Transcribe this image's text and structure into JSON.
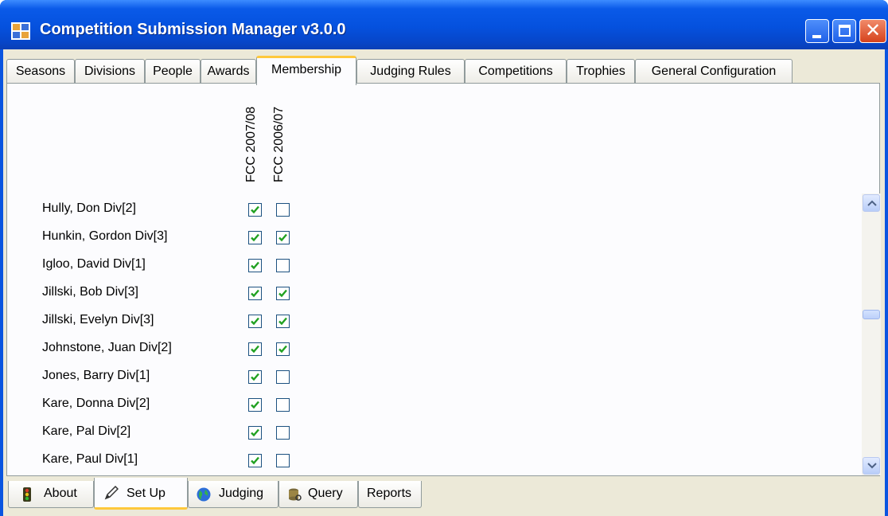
{
  "window": {
    "title": "Competition Submission Manager v3.0.0"
  },
  "top_tabs": [
    {
      "label": "Seasons",
      "active": false
    },
    {
      "label": "Divisions",
      "active": false
    },
    {
      "label": "People",
      "active": false
    },
    {
      "label": "Awards",
      "active": false
    },
    {
      "label": "Membership",
      "active": true
    },
    {
      "label": "Judging Rules",
      "active": false
    },
    {
      "label": "Competitions",
      "active": false
    },
    {
      "label": "Trophies",
      "active": false
    },
    {
      "label": "General Configuration",
      "active": false
    }
  ],
  "membership": {
    "columns": [
      "FCC 2007/08",
      "FCC 2006/07"
    ],
    "rows": [
      {
        "label": "Hully, Don    Div[2]",
        "checked": [
          true,
          false
        ]
      },
      {
        "label": "Hunkin, Gordon    Div[3]",
        "checked": [
          true,
          true
        ]
      },
      {
        "label": "Igloo, David    Div[1]",
        "checked": [
          true,
          false
        ]
      },
      {
        "label": "Jillski, Bob    Div[3]",
        "checked": [
          true,
          true
        ]
      },
      {
        "label": "Jillski, Evelyn    Div[3]",
        "checked": [
          true,
          true
        ]
      },
      {
        "label": "Johnstone, Juan    Div[2]",
        "checked": [
          true,
          true
        ]
      },
      {
        "label": "Jones, Barry    Div[1]",
        "checked": [
          true,
          false
        ]
      },
      {
        "label": "Kare, Donna    Div[2]",
        "checked": [
          true,
          false
        ]
      },
      {
        "label": "Kare, Pal    Div[2]",
        "checked": [
          true,
          false
        ]
      },
      {
        "label": "Kare, Paul    Div[1]",
        "checked": [
          true,
          false
        ]
      }
    ]
  },
  "bottom_tabs": [
    {
      "label": "About",
      "icon": "traffic-light-icon",
      "active": false
    },
    {
      "label": "Set Up",
      "icon": "pencil-icon",
      "active": true
    },
    {
      "label": "Judging",
      "icon": "globe-icon",
      "active": false
    },
    {
      "label": "Query",
      "icon": "database-icon",
      "active": false
    },
    {
      "label": "Reports",
      "icon": "",
      "active": false
    }
  ],
  "colors": {
    "titlebar": "#0551de",
    "tab_accent": "#ffc83c",
    "checkmark": "#21a121",
    "panel": "#ece9d8"
  }
}
